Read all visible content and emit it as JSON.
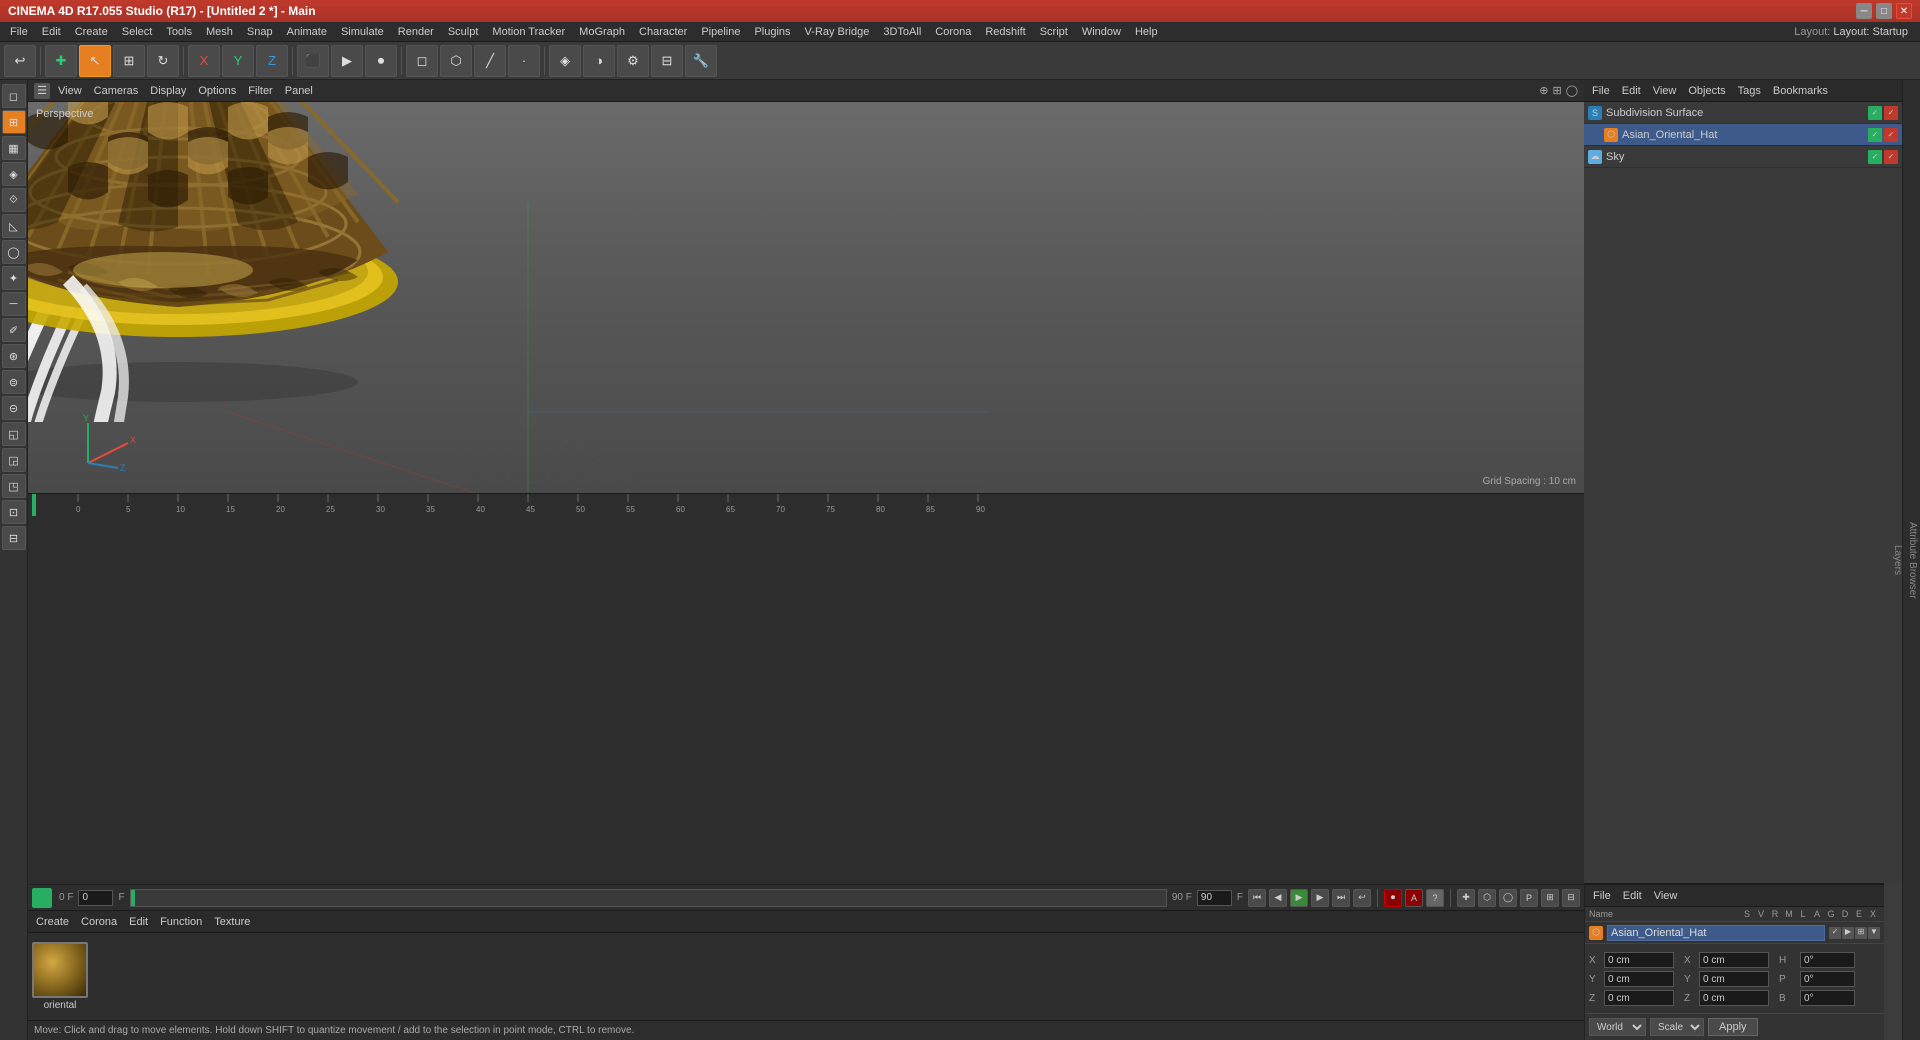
{
  "window": {
    "title": "CINEMA 4D R17.055 Studio (R17) - [Untitled 2 *] - Main",
    "layout_label": "Layout: Startup"
  },
  "menu": {
    "items": [
      "File",
      "Edit",
      "Create",
      "Select",
      "Tools",
      "Mesh",
      "Snap",
      "Animate",
      "Simulate",
      "Render",
      "Sculpt",
      "Motion Tracker",
      "MoGraph",
      "Character",
      "Pipeline",
      "Plugins",
      "V-Ray Bridge",
      "3DToAll",
      "Corona",
      "Redshift",
      "Script",
      "Window",
      "Help"
    ]
  },
  "viewport": {
    "label": "Perspective",
    "grid_spacing": "Grid Spacing : 10 cm",
    "menus": [
      "View",
      "Cameras",
      "Display",
      "Options",
      "Filter",
      "Panel"
    ]
  },
  "object_manager": {
    "header_menus": [
      "File",
      "Edit",
      "View",
      "Objects",
      "Tags",
      "Bookmarks"
    ],
    "objects": [
      {
        "name": "Subdivision Surface",
        "icon": "blue",
        "indent": 0
      },
      {
        "name": "Asian_Oriental_Hat",
        "icon": "orange",
        "indent": 1
      },
      {
        "name": "Sky",
        "icon": "sky",
        "indent": 0
      }
    ]
  },
  "attributes": {
    "header_menus": [
      "File",
      "Edit",
      "View"
    ],
    "col_headers": [
      "Name",
      "S",
      "V",
      "R",
      "M",
      "L",
      "A",
      "G",
      "D",
      "E",
      "X"
    ],
    "selected_object": "Asian_Oriental_Hat",
    "coords": {
      "x": {
        "pos": "0 cm",
        "extra_label": "H",
        "extra_val": "0°"
      },
      "y": {
        "pos": "0 cm",
        "extra_label": "P",
        "extra_val": "0°"
      },
      "z": {
        "pos": "0 cm",
        "extra_label": "B",
        "extra_val": "0°"
      }
    },
    "world_label": "World",
    "scale_label": "Scale",
    "apply_label": "Apply"
  },
  "material": {
    "menus": [
      "Create",
      "Corona",
      "Edit",
      "Function",
      "Texture"
    ],
    "name": "oriental"
  },
  "transport": {
    "frame_current": "0 F",
    "frame_start": "0",
    "frame_end": "90 F",
    "timeline_end": "90"
  },
  "status": {
    "text": "Move: Click and drag to move elements. Hold down SHIFT to quantize movement / add to the selection in point mode, CTRL to remove."
  },
  "toolbar": {
    "icons": [
      "↩",
      "✚",
      "↖",
      "⊕",
      "⊞",
      "⊠",
      "X",
      "Y",
      "Z",
      "▣",
      "◐",
      "◑",
      "⬡",
      "◈",
      "❋",
      "⚙",
      "◫",
      "⊟",
      "⬤"
    ]
  },
  "left_tools": [
    "◻",
    "☑",
    "▦",
    "◈",
    "⟐",
    "⬟",
    "◺",
    "⬠",
    "◯",
    "⬡",
    "─",
    "✐",
    "⊛",
    "⊜",
    "⊝",
    "◱",
    "◲",
    "◳"
  ]
}
